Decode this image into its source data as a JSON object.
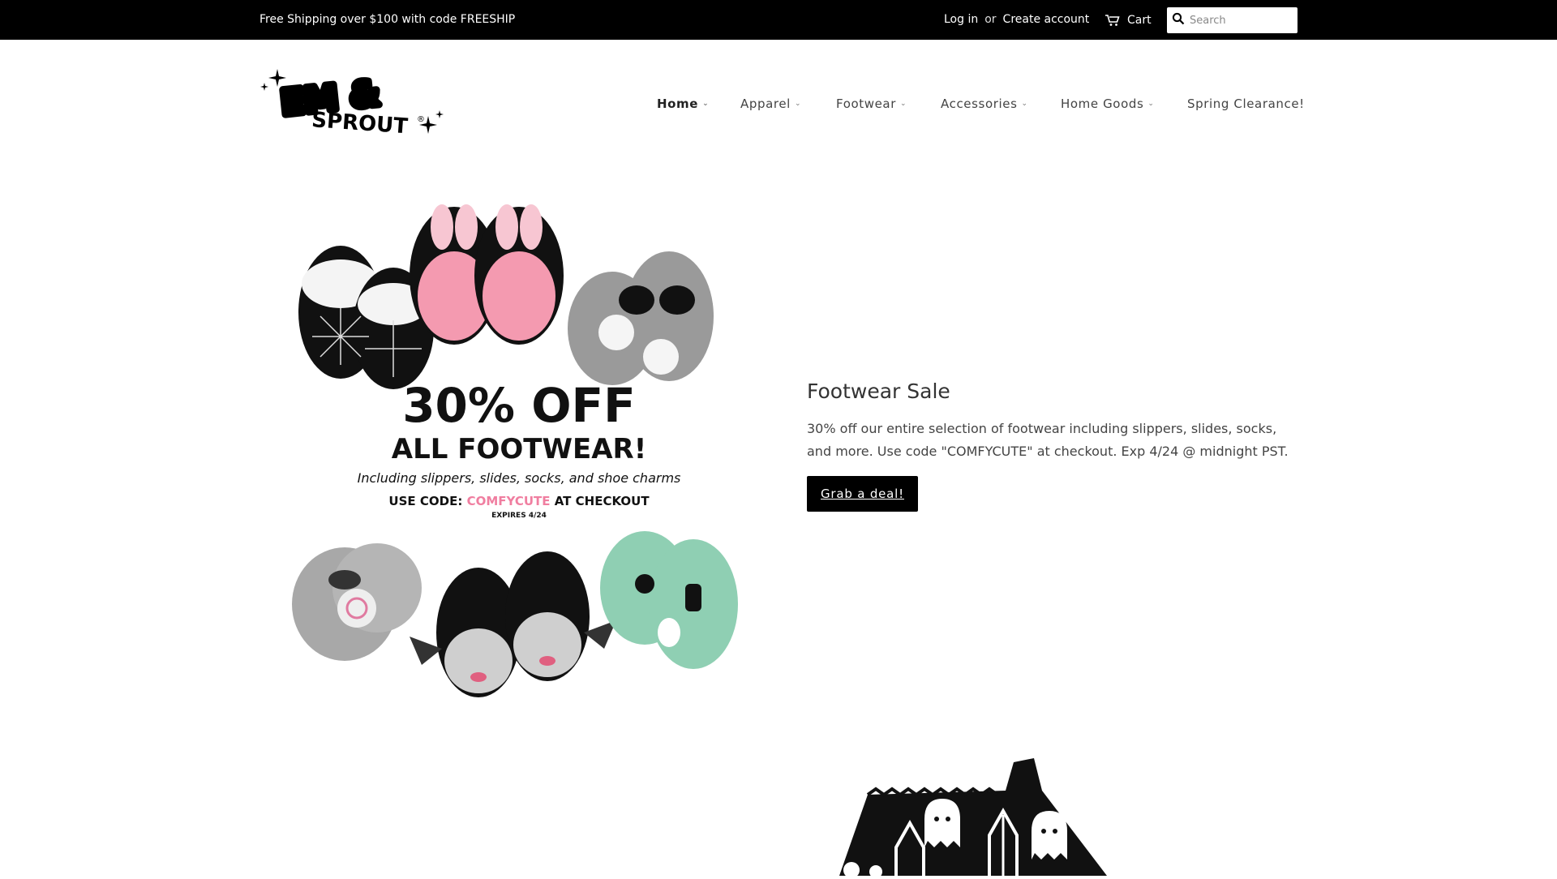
{
  "topbar": {
    "promo": "Free Shipping over $100 with code FREESHIP",
    "login": "Log in",
    "or": "or",
    "create_account": "Create account",
    "cart": "Cart",
    "search_placeholder": "Search"
  },
  "nav": {
    "items": [
      {
        "label": "Home",
        "has_dropdown": true,
        "active": true
      },
      {
        "label": "Apparel",
        "has_dropdown": true
      },
      {
        "label": "Footwear",
        "has_dropdown": true
      },
      {
        "label": "Accessories",
        "has_dropdown": true
      },
      {
        "label": "Home Goods",
        "has_dropdown": true
      },
      {
        "label": "Spring Clearance!",
        "has_dropdown": false
      }
    ]
  },
  "logo": {
    "text": "EM & SPROUT"
  },
  "hero": {
    "image": {
      "line1": "30% OFF",
      "line2": "ALL FOOTWEAR!",
      "line3": "Including slippers, slides, socks, and shoe charms",
      "line4_prefix": "USE CODE:",
      "line4_code": "COMFYCUTE",
      "line4_suffix": "AT CHECKOUT",
      "line5": "EXPIRES 4/24"
    },
    "title": "Footwear Sale",
    "description": "30% off our entire selection of footwear including slippers, slides, socks, and more. Use code \"COMFYCUTE\" at checkout. Exp 4/24 @ midnight PST.",
    "button": "Grab a deal!"
  },
  "colors": {
    "topbar_bg": "#000000",
    "accent_pink": "#f07ea0",
    "button_bg": "#000000"
  }
}
